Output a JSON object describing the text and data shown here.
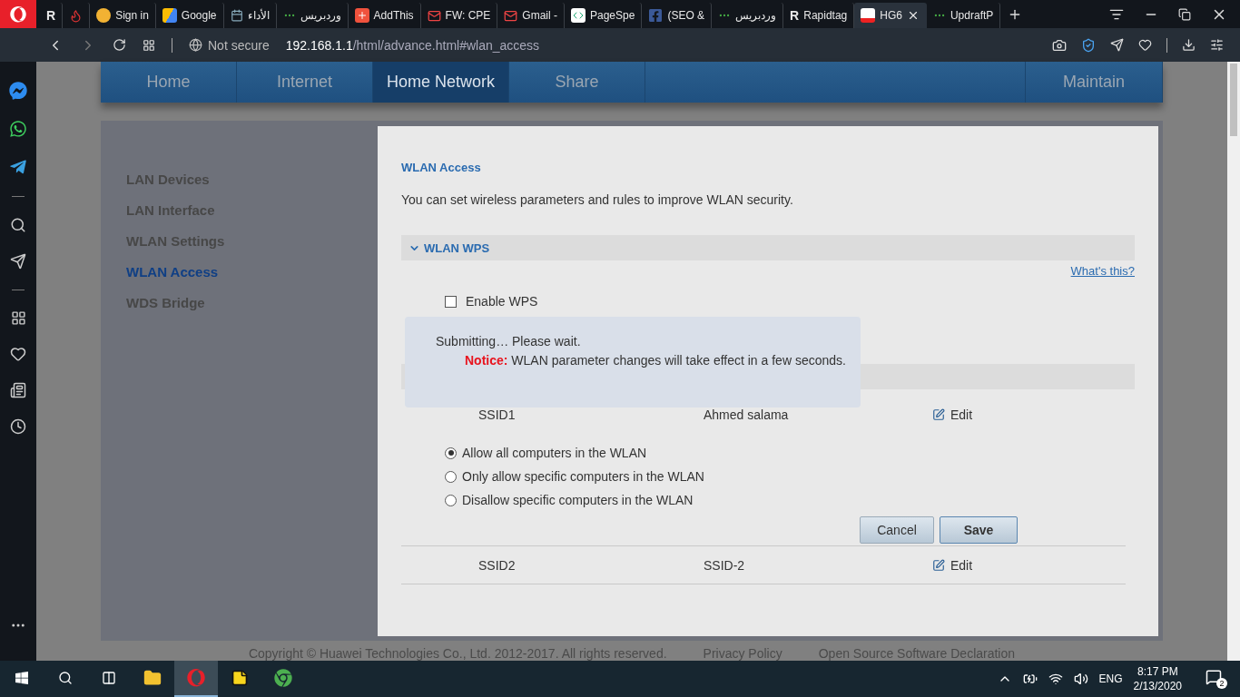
{
  "browser": {
    "tabs": [
      {
        "kind": "letter",
        "label": "R",
        "selected": false
      },
      {
        "kind": "flame",
        "selected": false
      },
      {
        "kind": "face",
        "label": "Sign in",
        "selected": false
      },
      {
        "kind": "ads",
        "label": "Google",
        "selected": false
      },
      {
        "kind": "calendar",
        "label": "الأداء",
        "selected": false
      },
      {
        "kind": "dots",
        "label": "وردبريس",
        "selected": false
      },
      {
        "kind": "plus",
        "label": "AddThis",
        "selected": false
      },
      {
        "kind": "mail",
        "label": "FW: CPE",
        "selected": false
      },
      {
        "kind": "mail",
        "label": "Gmail -",
        "selected": false
      },
      {
        "kind": "code",
        "label": "PageSpe",
        "selected": false
      },
      {
        "kind": "facebook",
        "label": "(SEO &",
        "selected": false
      },
      {
        "kind": "dots",
        "label": "وردبريس",
        "selected": false
      },
      {
        "kind": "letter",
        "label": "R",
        "selected": false
      },
      {
        "kind": "router",
        "label": "HG6",
        "selected": true
      },
      {
        "kind": "dots",
        "label": "UpdraftP",
        "selected": false
      }
    ],
    "rapid_tab_label": "Rapidtag",
    "security": "Not secure",
    "url": "**192.168.1.1**/html/advance.html#wlan_access"
  },
  "router_page": {
    "nav": [
      {
        "label": "Home",
        "selected": false
      },
      {
        "label": "Internet",
        "selected": false
      },
      {
        "label": "Home Network",
        "selected": true
      },
      {
        "label": "Share",
        "selected": false
      },
      {
        "label": "Maintain",
        "selected": false
      }
    ],
    "menu": [
      {
        "label": "LAN Devices",
        "selected": false
      },
      {
        "label": "LAN Interface",
        "selected": false
      },
      {
        "label": "WLAN Settings",
        "selected": false
      },
      {
        "label": "WLAN Access",
        "selected": true
      },
      {
        "label": "WDS Bridge",
        "selected": false
      }
    ],
    "title": "WLAN Access",
    "description": "You can set wireless parameters and rules to improve WLAN security.",
    "wps_section": {
      "title": "WLAN WPS",
      "expanded": true,
      "help_link": "What's this?",
      "enable_label": "Enable WPS",
      "enable_checked": false
    },
    "ssids": [
      {
        "name": "SSID1",
        "value": "Ahmed salama",
        "action": "Edit",
        "expanded": true
      },
      {
        "name": "SSID2",
        "value": "SSID-2",
        "action": "Edit",
        "expanded": false
      }
    ],
    "access_options": [
      {
        "label": "Allow all computers in the WLAN",
        "selected": true
      },
      {
        "label": "Only allow specific computers in the WLAN",
        "selected": false
      },
      {
        "label": "Disallow specific computers in the WLAN",
        "selected": false
      }
    ],
    "buttons": {
      "cancel": "Cancel",
      "save": "Save"
    },
    "footer": [
      "Copyright © Huawei Technologies Co., Ltd. 2012-2017. All rights reserved.",
      "Privacy Policy",
      "Open Source Software Declaration"
    ],
    "dialog": {
      "message": "Submitting… Please wait.",
      "notice_label": "Notice:",
      "notice": "WLAN parameter changes will take effect in a few seconds."
    }
  },
  "taskbar": {
    "apps": [
      {
        "kind": "explorer",
        "selected": false
      },
      {
        "kind": "opera",
        "selected": true
      },
      {
        "kind": "notes",
        "selected": false
      },
      {
        "kind": "chrome",
        "selected": false
      }
    ],
    "language": "ENG",
    "time": "8:17 PM",
    "date": "2/13/2020",
    "notifications": "2"
  }
}
